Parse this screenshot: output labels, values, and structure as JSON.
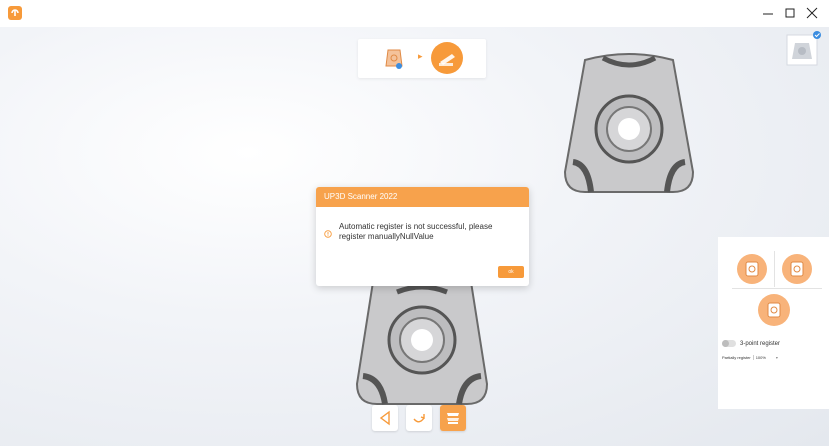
{
  "colors": {
    "accent": "#f79a3a",
    "header": "#f7a24c"
  },
  "window": {
    "logo_icon": "app-logo-icon",
    "min_icon": "minimize-icon",
    "max_icon": "maximize-icon",
    "close_icon": "close-icon"
  },
  "step_bar": {
    "step1_icon": "lower-jaw-icon",
    "step2_icon": "scanner-icon",
    "arrow": "▸"
  },
  "dialog": {
    "title": "UP3D Scanner 2022",
    "message": "Automatic register is not successful, please register manuallyNullValue",
    "ok_label": "ok"
  },
  "right_panel": {
    "toggle_label": "3-point register",
    "partial_label": "Partially register",
    "partial_value": "100%",
    "partial_dropdown_icon": "chevron-down-icon"
  },
  "bottom_tools": [
    "back-icon",
    "rotate-icon",
    "scan-icon"
  ]
}
